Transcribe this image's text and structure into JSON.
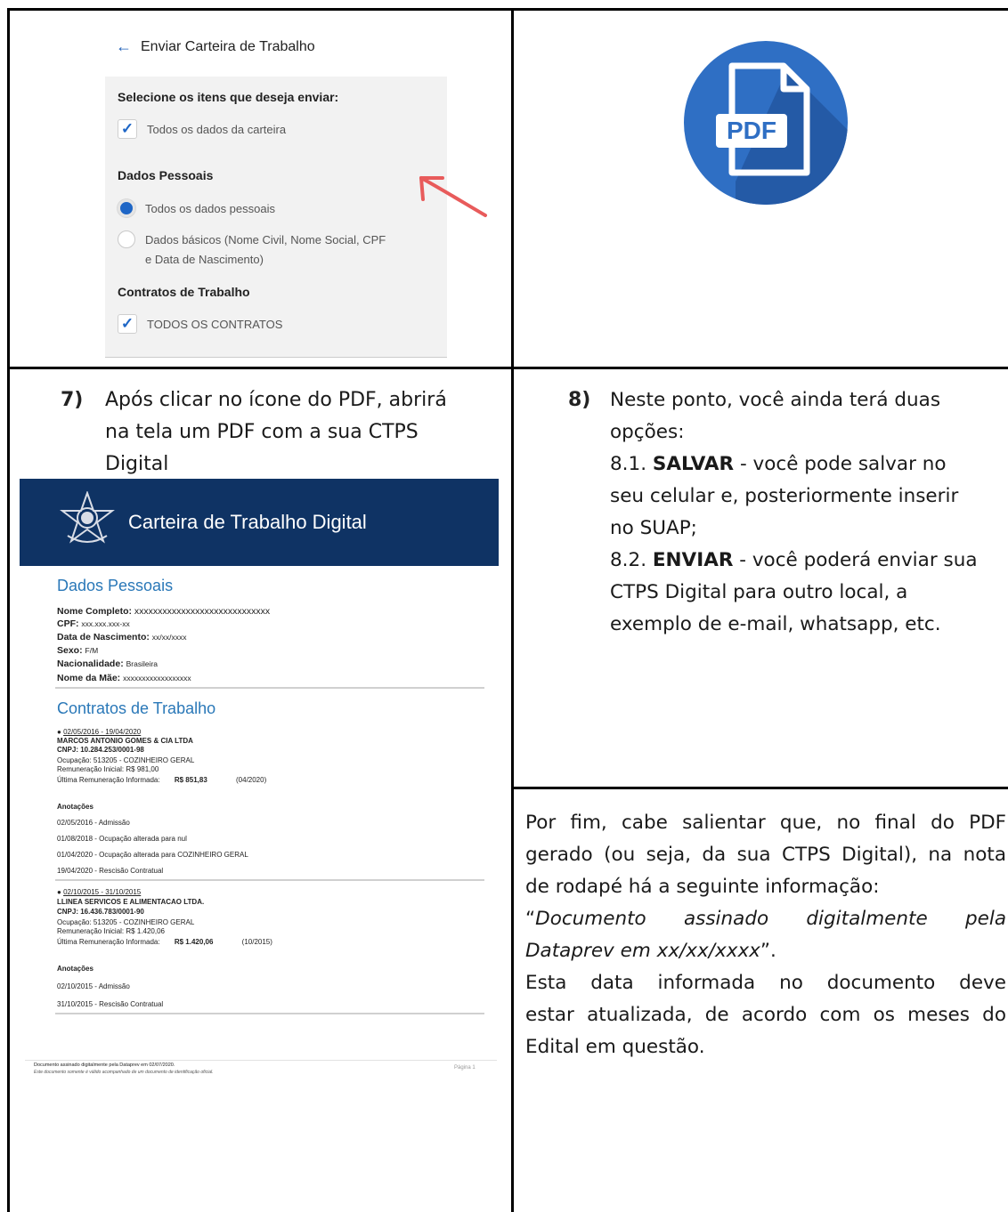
{
  "phone": {
    "header": "Enviar Carteira de Trabalho",
    "select_title": "Selecione os itens que deseja enviar:",
    "all_wallet": "Todos os dados da carteira",
    "personal_title": "Dados Pessoais",
    "all_personal": "Todos os dados pessoais",
    "basic_line1": "Dados básicos (Nome Civil, Nome Social, CPF",
    "basic_line2": "e Data de Nascimento)",
    "contracts_title": "Contratos de Trabalho",
    "all_contracts": "TODOS OS CONTRATOS"
  },
  "pdf_icon": {
    "label": "PDF",
    "color": "#2f6fc4"
  },
  "step7": {
    "number": "7)",
    "line1": "Após clicar no ícone do PDF, abrirá",
    "line2": "na tela um PDF com a sua CTPS",
    "line3": "Digital"
  },
  "step8": {
    "number": "8)",
    "line1": "Neste ponto, você ainda terá duas",
    "line2": "opções:",
    "save_num": "8.1. ",
    "save_label": "SALVAR",
    "save_text": " - você pode salvar no",
    "save_line2": "seu celular e, posteriormente inserir",
    "save_line3": "no SUAP;",
    "send_num": "8.2. ",
    "send_label": "ENVIAR",
    "send_text": " - você poderá enviar sua",
    "send_line2": "CTPS Digital para outro local, a",
    "send_line3": "exemplo de e-mail, whatsapp, etc."
  },
  "doc": {
    "banner_title": "Carteira de Trabalho Digital",
    "personal_heading": "Dados Pessoais",
    "name_label": "Nome Completo:",
    "name_value": "xxxxxxxxxxxxxxxxxxxxxxxxxxxxx",
    "cpf_label": "CPF:",
    "cpf_value": "xxx.xxx.xxx-xx",
    "birth_label": "Data de Nascimento:",
    "birth_value": "xx/xx/xxxx",
    "sex_label": "Sexo:",
    "sex_value": "F/M",
    "nat_label": "Nacionalidade:",
    "nat_value": "Brasileira",
    "mother_label": "Nome da Mãe:",
    "mother_value": "xxxxxxxxxxxxxxxxxx",
    "contracts_heading": "Contratos de Trabalho",
    "c1_period": "02/05/2016 - 19/04/2020",
    "c1_company": "MARCOS ANTONIO GOMES & CIA LTDA",
    "c1_cnpj": "CNPJ: 10.284.253/0001-98",
    "c1_occupation": "Ocupação: 513205 - COZINHEIRO GERAL",
    "c1_initial": "Remuneração Inicial:   R$ 981,00",
    "c1_last_label": "Última Remuneração Informada:",
    "c1_last_value": "R$ 851,83",
    "c1_last_date": "(04/2020)",
    "notes_label": "Anotações",
    "c1_note1": "02/05/2016 - Admissão",
    "c1_note2": "01/08/2018 - Ocupação alterada para nul",
    "c1_note3": "01/04/2020 - Ocupação alterada para COZINHEIRO GERAL",
    "c1_note4": "19/04/2020 - Rescisão Contratual",
    "c2_period": "02/10/2015 - 31/10/2015",
    "c2_company": "LLINEA SERVICOS E ALIMENTACAO LTDA.",
    "c2_cnpj": "CNPJ: 16.436.783/0001-90",
    "c2_occupation": "Ocupação: 513205 - COZINHEIRO GERAL",
    "c2_initial": "Remuneração Inicial:   R$ 1.420,06",
    "c2_last_label": "Última Remuneração Informada:",
    "c2_last_value": "R$ 1.420,06",
    "c2_last_date": "(10/2015)",
    "c2_note1": "02/10/2015 - Admissão",
    "c2_note2": "31/10/2015 - Rescisão Contratual",
    "footer_line1": "Documento assinado digitalmente pela Dataprev em 02/07/2020.",
    "footer_line2": "Este documento somente é válido acompanhado de um documento de identificação oficial.",
    "page_label": "Página 1"
  },
  "final": {
    "l1": "Por fim, cabe salientar que, no final do PDF",
    "l2": "gerado (ou seja, da sua CTPS Digital), na nota",
    "l3": "de rodapé há a seguinte informação:",
    "quote_open": "“",
    "quote_italic_1": "Documento assinado digitalmente pela",
    "quote_italic_2": "Dataprev em xx/xx/xxxx",
    "quote_close": "”.",
    "l6": "Esta data informada no documento deve",
    "l7": "estar atualizada, de acordo com os meses do",
    "l8": "Edital em questão."
  }
}
